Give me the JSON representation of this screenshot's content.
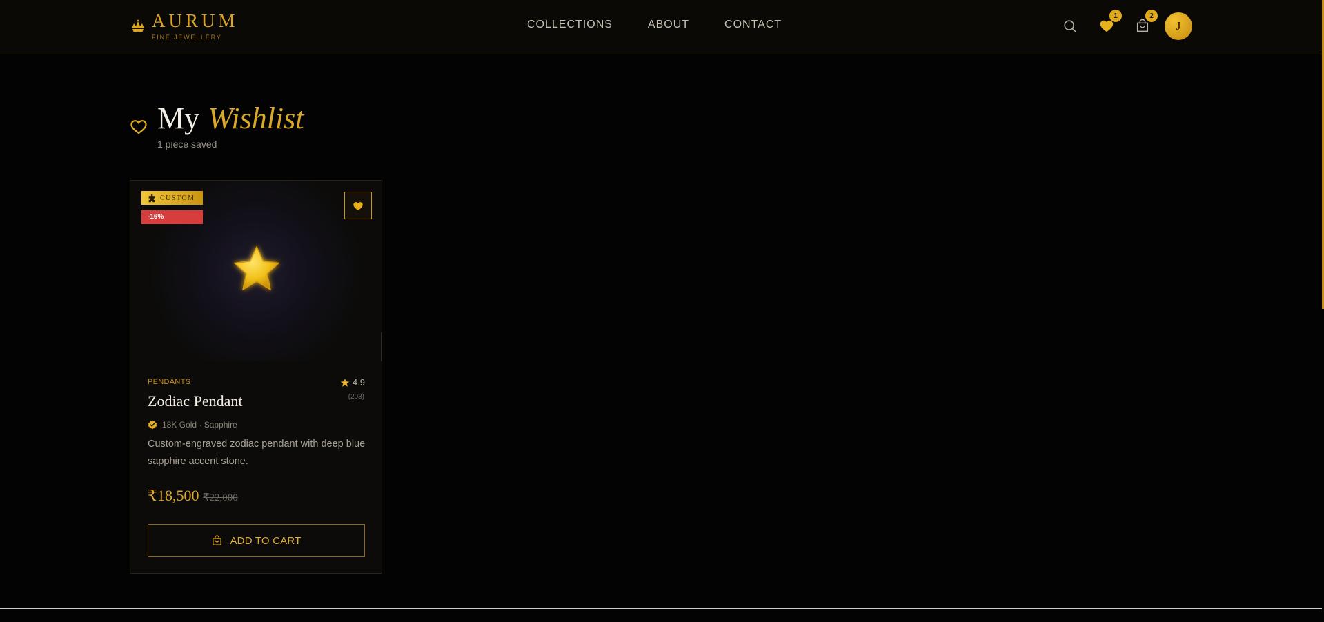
{
  "brand": {
    "name": "AURUM",
    "tagline": "FINE JEWELLERY"
  },
  "nav": {
    "items": [
      "COLLECTIONS",
      "ABOUT",
      "CONTACT"
    ]
  },
  "header": {
    "wishlist_count": "1",
    "cart_count": "2",
    "avatar_initial": "J"
  },
  "page": {
    "title_plain": "My",
    "title_accent": "Wishlist",
    "subtitle": "1 piece saved"
  },
  "products": [
    {
      "tag": "CUSTOM",
      "discount": "-16%",
      "category": "PENDANTS",
      "rating": "4.9",
      "reviews": "(203)",
      "name": "Zodiac Pendant",
      "material": "18K Gold · Sapphire",
      "description": "Custom-engraved zodiac pendant with deep blue sapphire accent stone.",
      "price": "₹18,500",
      "original_price": "₹22,000",
      "cta": "ADD TO CART"
    }
  ],
  "colors": {
    "gold": "#d9a520",
    "background": "#030303",
    "header": "#0b0906",
    "discount": "#d73d3d"
  },
  "icons": [
    "crown-logo-icon",
    "search-icon",
    "heart-icon",
    "shopping-bag-icon",
    "star-icon",
    "verified-badge-icon",
    "puzzle-icon"
  ]
}
